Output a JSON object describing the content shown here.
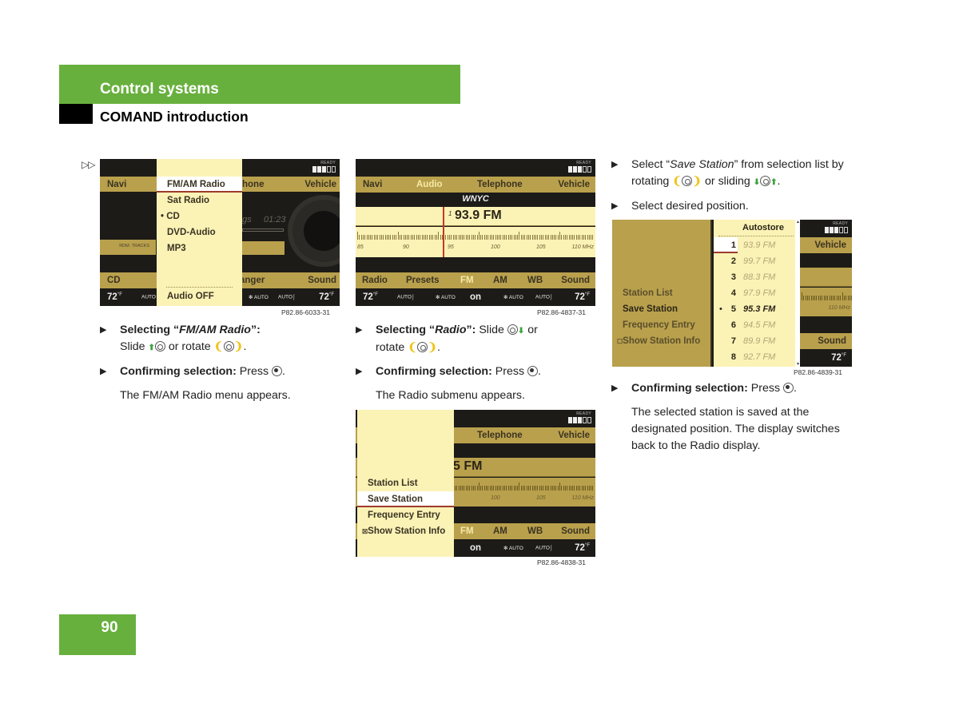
{
  "header": {
    "section": "Control systems",
    "subsection": "COMAND introduction"
  },
  "continuation_marker": "▷▷",
  "page_number": "90",
  "colors": {
    "header_green": "#68b03e",
    "screen_gold": "#b9a04c",
    "menu_yellow": "#fbf2b6",
    "selection_line": "#9b3b2b",
    "screen_dark": "#1c1b18"
  },
  "screens": {
    "s1": {
      "code": "P82.86-6033-31",
      "ready": "READY",
      "top_tabs": [
        "Navi",
        "hone",
        "Vehicle"
      ],
      "menu": [
        "FM/AM Radio",
        "Sat Radio",
        "• CD",
        "DVD-Audio",
        "MP3",
        "Audio OFF"
      ],
      "selected": "FM/AM Radio",
      "side_label": "RDM. TRACKS",
      "track_time": "01:23",
      "track_frag": "gs",
      "bottom_tabs": [
        "CD",
        "anger",
        "Sound"
      ],
      "climate": {
        "left": "72",
        "right": "72",
        "unit": "°F",
        "auto": "AUTO"
      }
    },
    "s2": {
      "code": "P82.86-4837-31",
      "ready": "READY",
      "top_tabs": [
        "Navi",
        "Audio",
        "Telephone",
        "Vehicle"
      ],
      "active_top": "Audio",
      "station_name": "WNYC",
      "frequency": "93.9 FM",
      "freq_marker": "1",
      "scale": [
        "85",
        "90",
        "95",
        "100",
        "105",
        "110 MHz"
      ],
      "tuned_mhz": 93.9,
      "bottom_tabs": [
        "Radio",
        "Presets",
        "FM",
        "AM",
        "WB",
        "Sound"
      ],
      "active_bottom": "FM",
      "climate": {
        "left": "72",
        "right": "72",
        "unit": "°F",
        "auto": "AUTO",
        "on": "on"
      }
    },
    "s3": {
      "code": "P82.86-4838-31",
      "ready": "READY",
      "top_tabs": [
        "Telephone",
        "Vehicle"
      ],
      "freq_frag": "5 FM",
      "scale": [
        "100",
        "105",
        "110 MHz"
      ],
      "menu": [
        "Station List",
        "Save Station",
        "Frequency Entry",
        "Show Station Info"
      ],
      "selected": "Save Station",
      "bottom_tabs": [
        "FM",
        "AM",
        "WB",
        "Sound"
      ],
      "climate": {
        "right": "72",
        "unit": "°F",
        "auto": "AUTO",
        "on": "on"
      }
    },
    "s4": {
      "code": "P82.86-4839-31",
      "ready": "READY",
      "menu": [
        "Station List",
        "Save Station",
        "Frequency Entry",
        "Show Station Info"
      ],
      "list_title": "Autostore",
      "presets": [
        {
          "pos": "1",
          "freq": "93.9 FM"
        },
        {
          "pos": "2",
          "freq": "99.7 FM"
        },
        {
          "pos": "3",
          "freq": "88.3 FM"
        },
        {
          "pos": "4",
          "freq": "97.9 FM"
        },
        {
          "pos": "5",
          "freq": "95.3 FM",
          "current": true
        },
        {
          "pos": "6",
          "freq": "94.5 FM"
        },
        {
          "pos": "7",
          "freq": "89.9 FM"
        },
        {
          "pos": "8",
          "freq": "92.7 FM"
        }
      ],
      "selected_pos": "1",
      "right_tabs": [
        "Vehicle",
        "Sound"
      ],
      "scale": "110 MHz",
      "climate": {
        "right": "72",
        "unit": "°F"
      }
    }
  },
  "col1": {
    "step1_bold": "Selecting “",
    "step1_italic": "FM/AM Radio",
    "step1_bold_end": "”:",
    "step1_text_a": "Slide",
    "step1_text_b": "or rotate",
    "step2_bold": "Confirming selection:",
    "step2_text": "Press",
    "result": "The FM/AM Radio menu appears."
  },
  "col2": {
    "step1_bold": "Selecting “",
    "step1_italic": "Radio",
    "step1_bold_end": "”:",
    "step1_text_a": "Slide",
    "step1_text_b": "or",
    "step1_text_c": "rotate",
    "step2_bold": "Confirming selection:",
    "step2_text": "Press",
    "result": "The Radio submenu appears."
  },
  "col3": {
    "step1_a": "Select “",
    "step1_italic": "Save Station",
    "step1_b": "” from selection list by rotating",
    "step1_c": "or sliding",
    "step2": "Select desired position.",
    "step3_bold": "Confirming selection:",
    "step3_text": "Press",
    "result": "The selected station is saved at the designated position. The display switches back to the Radio display."
  }
}
